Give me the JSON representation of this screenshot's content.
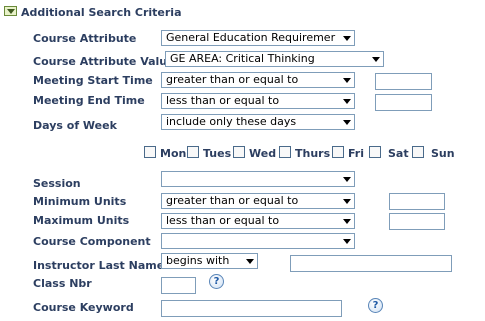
{
  "section": {
    "title": "Additional Search Criteria"
  },
  "fields": {
    "course_attribute": {
      "label": "Course Attribute",
      "value": "General Education Requiremer"
    },
    "course_attribute_value": {
      "label": "Course Attribute Value",
      "value": "GE AREA: Critical Thinking"
    },
    "meeting_start_time": {
      "label": "Meeting Start Time",
      "operator": "greater than or equal to",
      "value": ""
    },
    "meeting_end_time": {
      "label": "Meeting End Time",
      "operator": "less than or equal to",
      "value": ""
    },
    "days_of_week": {
      "label": "Days of Week",
      "operator": "include only these days"
    },
    "session": {
      "label": "Session",
      "value": ""
    },
    "minimum_units": {
      "label": "Minimum Units",
      "operator": "greater than or equal to",
      "value": ""
    },
    "maximum_units": {
      "label": "Maximum Units",
      "operator": "less than or equal to",
      "value": ""
    },
    "course_component": {
      "label": "Course Component",
      "value": ""
    },
    "instructor_last_name": {
      "label": "Instructor Last Name",
      "operator": "begins with",
      "value": ""
    },
    "class_nbr": {
      "label": "Class Nbr",
      "value": ""
    },
    "course_keyword": {
      "label": "Course Keyword",
      "value": ""
    }
  },
  "days": [
    {
      "label": "Mon",
      "checked": false
    },
    {
      "label": "Tues",
      "checked": false
    },
    {
      "label": "Wed",
      "checked": false
    },
    {
      "label": "Thurs",
      "checked": false
    },
    {
      "label": "Fri",
      "checked": false
    },
    {
      "label": "Sat",
      "checked": false
    },
    {
      "label": "Sun",
      "checked": false
    }
  ],
  "help_icon": "question-mark",
  "colors": {
    "label": "#2c3e60",
    "field_border": "#7f9db9",
    "help_icon": "#1f5aa6"
  }
}
